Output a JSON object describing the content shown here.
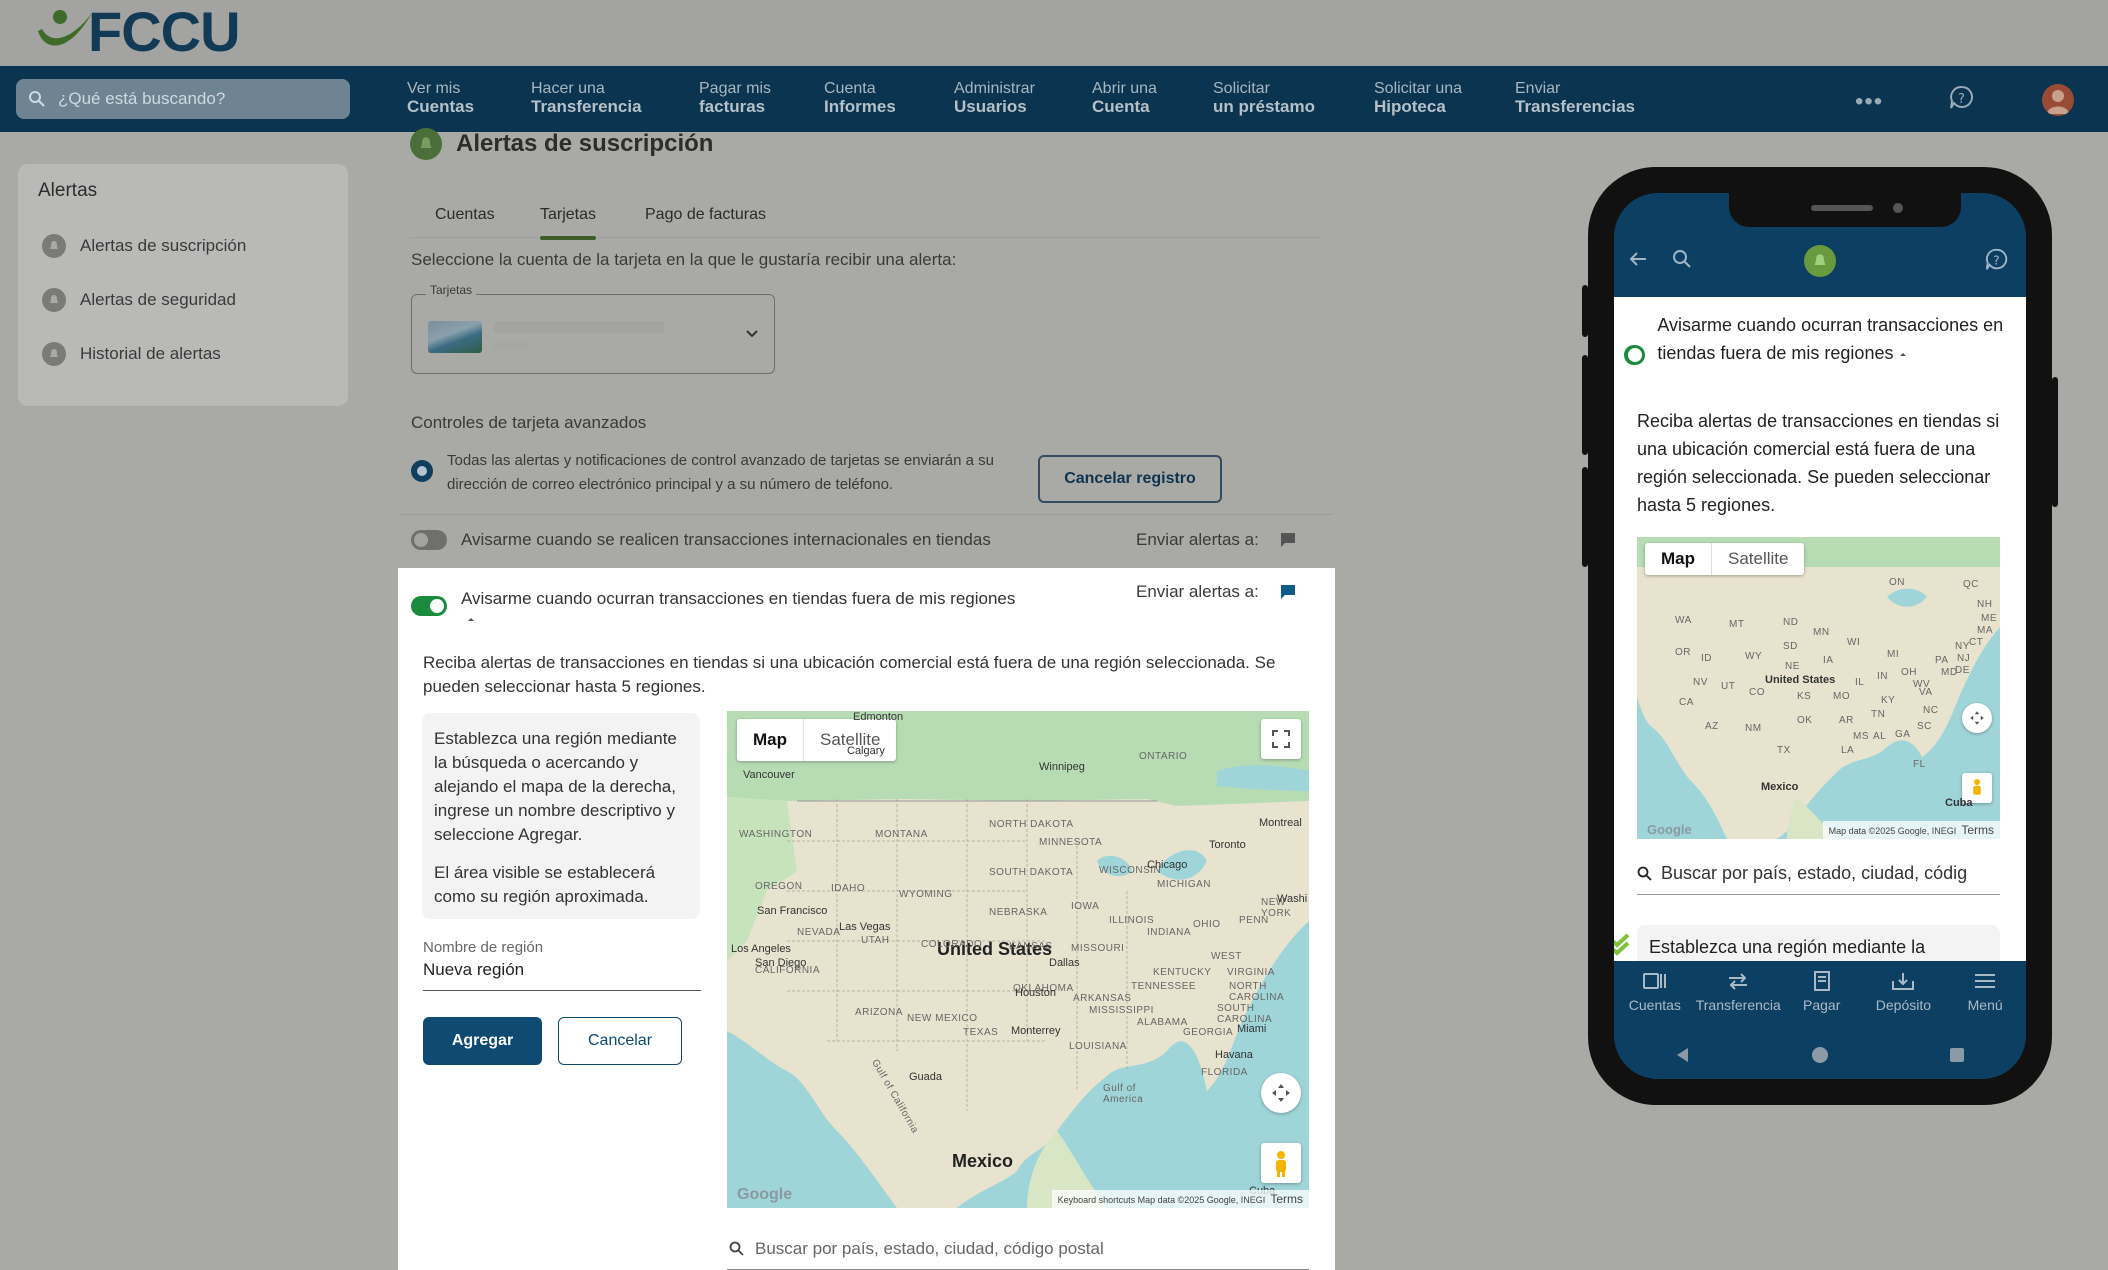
{
  "brand": {
    "logo_text": "FCCU"
  },
  "search": {
    "placeholder": "¿Qué está buscando?"
  },
  "nav": [
    {
      "l1": "Ver mis",
      "l2": "Cuentas"
    },
    {
      "l1": "Hacer una",
      "l2": "Transferencia"
    },
    {
      "l1": "Pagar mis",
      "l2": "facturas"
    },
    {
      "l1": "Cuenta",
      "l2": "Informes"
    },
    {
      "l1": "Administrar",
      "l2": "Usuarios"
    },
    {
      "l1": "Abrir una",
      "l2": "Cuenta"
    },
    {
      "l1": "Solicitar",
      "l2": "un préstamo"
    },
    {
      "l1": "Solicitar una",
      "l2": "Hipoteca"
    },
    {
      "l1": "Enviar",
      "l2": "Transferencias"
    }
  ],
  "nav_more": "•••",
  "sidebar": {
    "title": "Alertas",
    "items": [
      {
        "label": "Alertas de suscripción"
      },
      {
        "label": "Alertas de seguridad"
      },
      {
        "label": "Historial de alertas"
      }
    ]
  },
  "page": {
    "title": "Alertas de suscripción",
    "tabs": [
      "Cuentas",
      "Tarjetas",
      "Pago de facturas"
    ],
    "active_tab": "Tarjetas",
    "instruction": "Seleccione la cuenta de la tarjeta en la que le gustaría recibir una alerta:",
    "card_select_label": "Tarjetas",
    "advanced_title": "Controles de tarjeta avanzados",
    "advanced_info": "Todas las alertas y notificaciones de control avanzado de tarjetas se enviarán a su dirección de correo electrónico principal y a su número de teléfono.",
    "cancel_registration": "Cancelar registro",
    "row_international": {
      "label": "Avisarme cuando se realicen transacciones internacionales en tiendas",
      "enabled": false,
      "send_to": "Enviar alertas a:"
    },
    "row_regions": {
      "label": "Avisarme cuando ocurran transacciones en tiendas fuera de mis regiones",
      "enabled": true,
      "send_to": "Enviar alertas a:"
    },
    "regions_desc": "Reciba alertas de transacciones en tiendas si una ubicación comercial está fuera de una región seleccionada. Se pueden seleccionar hasta 5 regiones.",
    "hint_p1": "Establezca una región mediante la búsqueda o acercando y alejando el mapa de la derecha, ingrese un nombre descriptivo y seleccione Agregar.",
    "hint_p2": "El área visible se establecerá como su región aproximada.",
    "region_name_label": "Nombre de región",
    "region_name_value": "Nueva región",
    "add_label": "Agregar",
    "cancel_label": "Cancelar",
    "map_search_placeholder": "Buscar por país, estado, ciudad, código postal"
  },
  "map": {
    "type_map": "Map",
    "type_satellite": "Satellite",
    "country_label": "United States",
    "mexico_label": "Mexico",
    "cuba_label": "Cuba",
    "attribution": "Keyboard shortcuts   Map data ©2025 Google, INEGI",
    "terms": "Terms",
    "google": "Google",
    "states": [
      "WASHINGTON",
      "MONTANA",
      "NORTH DAKOTA",
      "MINNESOTA",
      "OREGON",
      "IDAHO",
      "WYOMING",
      "SOUTH DAKOTA",
      "WISCONSIN",
      "MICHIGAN",
      "NEBRASKA",
      "IOWA",
      "NEVADA",
      "UTAH",
      "COLORADO",
      "KANSAS",
      "MISSOURI",
      "ILLINOIS",
      "INDIANA",
      "OHIO",
      "PENN",
      "CALIFORNIA",
      "ARIZONA",
      "NEW MEXICO",
      "OKLAHOMA",
      "ARKANSAS",
      "TENNESSEE",
      "KENTUCKY",
      "WEST",
      "VIRGINIA",
      "NORTH CAROLINA",
      "SOUTH CAROLINA",
      "TEXAS",
      "MISSISSIPPI",
      "ALABAMA",
      "GEORGIA",
      "LOUISIANA",
      "FLORIDA",
      "ONTARIO",
      "NEW YORK",
      "Gulf of America",
      "Gulf of California"
    ],
    "cities": [
      "Edmonton",
      "Calgary",
      "Vancouver",
      "Winnipeg",
      "Montreal",
      "Toronto",
      "Chicago",
      "San Francisco",
      "Las Vegas",
      "Los Angeles",
      "San Diego",
      "Dallas",
      "Houston",
      "Monterrey",
      "Miami",
      "Havana",
      "Washi",
      "Guada"
    ]
  },
  "phone": {
    "toggle_label": "Avisarme cuando ocurran transacciones en tiendas fuera de mis regiones",
    "desc": "Reciba alertas de transacciones en tiendas si una ubicación comercial está fuera de una región seleccionada. Se pueden seleccionar hasta 5 regiones.",
    "map_type_map": "Map",
    "map_type_satellite": "Satellite",
    "map_country": "United States",
    "map_mexico": "Mexico",
    "map_cuba": "Cuba",
    "map_attr": "Map data ©2025 Google, INEGI",
    "map_terms": "Terms",
    "map_google": "Google",
    "map_states": [
      "WA",
      "MT",
      "ND",
      "MN",
      "OR",
      "ID",
      "SD",
      "WY",
      "NE",
      "IA",
      "WI",
      "MI",
      "NV",
      "UT",
      "CO",
      "KS",
      "MO",
      "IL",
      "IN",
      "OH",
      "PA",
      "NY",
      "CA",
      "AZ",
      "NM",
      "OK",
      "AR",
      "TN",
      "KY",
      "VA",
      "NC",
      "SC",
      "TX",
      "MS",
      "AL",
      "GA",
      "LA",
      "FL",
      "ON",
      "QC",
      "ME",
      "NH",
      "MA",
      "CT",
      "NJ",
      "DE",
      "MD",
      "WV"
    ],
    "search_placeholder": "Buscar por país, estado, ciudad, códig",
    "hint_partial": "Establezca una región mediante la",
    "tabs": [
      "Cuentas",
      "Transferencia",
      "Pagar",
      "Depósito",
      "Menú"
    ]
  },
  "colors": {
    "navy": "#0a3450",
    "green": "#1a8a3c",
    "button_blue": "#0e4a72"
  }
}
